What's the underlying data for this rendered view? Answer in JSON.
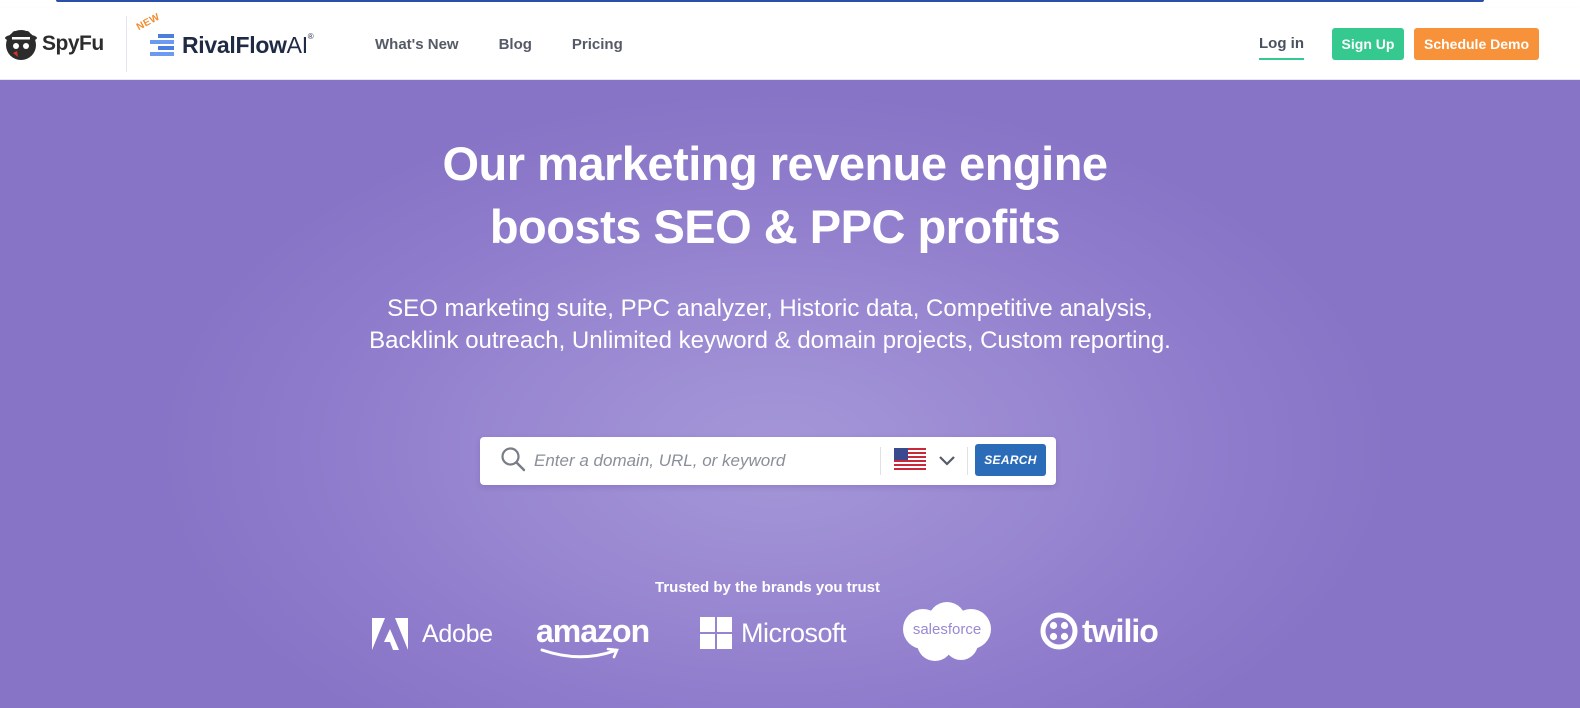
{
  "nav": {
    "spyfu_logo": "SpyFu",
    "rivalflow_new_tag": "NEW",
    "rivalflow_logo": "RivalFlow",
    "rivalflow_ai": "AI",
    "rivalflow_reg": "®",
    "links": [
      "What's New",
      "Blog",
      "Pricing"
    ],
    "login": "Log in",
    "signup": "Sign Up",
    "demo": "Schedule Demo"
  },
  "hero": {
    "headline_line1": "Our marketing revenue engine",
    "headline_line2": "boosts SEO & PPC profits",
    "subhead": "SEO marketing suite, PPC analyzer, Historic data, Competitive analysis, Backlink outreach, Unlimited keyword & domain projects, Custom reporting."
  },
  "search": {
    "placeholder": "Enter a domain, URL, or keyword",
    "value": "",
    "country_icon": "us-flag-icon",
    "button": "SEARCH"
  },
  "trusted": {
    "label": "Trusted by the brands you trust",
    "brands": [
      "Adobe",
      "amazon",
      "Microsoft",
      "salesforce",
      "twilio"
    ]
  },
  "colors": {
    "hero_bg": "#8e7bcb",
    "signup": "#36c98f",
    "demo": "#f8923a",
    "search_button": "#2b6cb8"
  }
}
